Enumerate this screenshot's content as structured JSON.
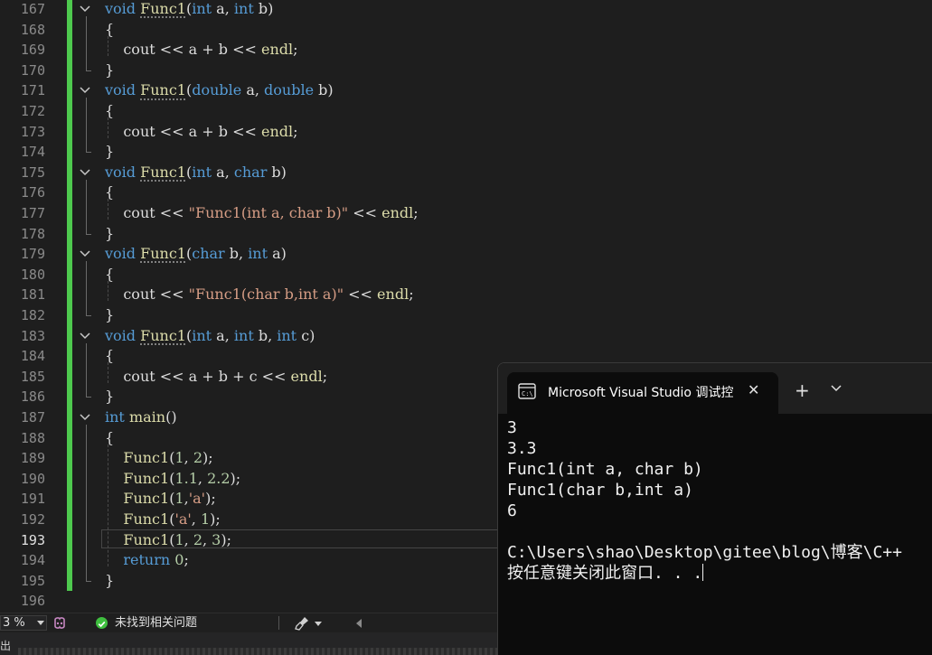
{
  "editor": {
    "lines": [
      {
        "n": "167",
        "tokens": [
          [
            "kw",
            "void"
          ],
          [
            "pl",
            " "
          ],
          [
            "fn",
            "Func1"
          ],
          [
            "pl",
            "("
          ],
          [
            "kw",
            "int"
          ],
          [
            "pl",
            " a, "
          ],
          [
            "kw",
            "int"
          ],
          [
            "pl",
            " b)"
          ]
        ]
      },
      {
        "n": "168",
        "tokens": [
          [
            "pl",
            "{"
          ]
        ]
      },
      {
        "n": "169",
        "tokens": [
          [
            "pl",
            "    cout << a + b << "
          ],
          [
            "fnp",
            "endl"
          ],
          [
            "pl",
            ";"
          ]
        ]
      },
      {
        "n": "170",
        "tokens": [
          [
            "pl",
            "}"
          ]
        ]
      },
      {
        "n": "171",
        "tokens": [
          [
            "kw",
            "void"
          ],
          [
            "pl",
            " "
          ],
          [
            "fn",
            "Func1"
          ],
          [
            "pl",
            "("
          ],
          [
            "kw",
            "double"
          ],
          [
            "pl",
            " a, "
          ],
          [
            "kw",
            "double"
          ],
          [
            "pl",
            " b)"
          ]
        ]
      },
      {
        "n": "172",
        "tokens": [
          [
            "pl",
            "{"
          ]
        ]
      },
      {
        "n": "173",
        "tokens": [
          [
            "pl",
            "    cout << a + b << "
          ],
          [
            "fnp",
            "endl"
          ],
          [
            "pl",
            ";"
          ]
        ]
      },
      {
        "n": "174",
        "tokens": [
          [
            "pl",
            "}"
          ]
        ]
      },
      {
        "n": "175",
        "tokens": [
          [
            "kw",
            "void"
          ],
          [
            "pl",
            " "
          ],
          [
            "fn",
            "Func1"
          ],
          [
            "pl",
            "("
          ],
          [
            "kw",
            "int"
          ],
          [
            "pl",
            " a, "
          ],
          [
            "kw",
            "char"
          ],
          [
            "pl",
            " b)"
          ]
        ]
      },
      {
        "n": "176",
        "tokens": [
          [
            "pl",
            "{"
          ]
        ]
      },
      {
        "n": "177",
        "tokens": [
          [
            "pl",
            "    cout << "
          ],
          [
            "st",
            "\"Func1(int a, char b)\""
          ],
          [
            "pl",
            " << "
          ],
          [
            "fnp",
            "endl"
          ],
          [
            "pl",
            ";"
          ]
        ]
      },
      {
        "n": "178",
        "tokens": [
          [
            "pl",
            "}"
          ]
        ]
      },
      {
        "n": "179",
        "tokens": [
          [
            "kw",
            "void"
          ],
          [
            "pl",
            " "
          ],
          [
            "fn",
            "Func1"
          ],
          [
            "pl",
            "("
          ],
          [
            "kw",
            "char"
          ],
          [
            "pl",
            " b, "
          ],
          [
            "kw",
            "int"
          ],
          [
            "pl",
            " a)"
          ]
        ]
      },
      {
        "n": "180",
        "tokens": [
          [
            "pl",
            "{"
          ]
        ]
      },
      {
        "n": "181",
        "tokens": [
          [
            "pl",
            "    cout << "
          ],
          [
            "st",
            "\"Func1(char b,int a)\""
          ],
          [
            "pl",
            " << "
          ],
          [
            "fnp",
            "endl"
          ],
          [
            "pl",
            ";"
          ]
        ]
      },
      {
        "n": "182",
        "tokens": [
          [
            "pl",
            "}"
          ]
        ]
      },
      {
        "n": "183",
        "tokens": [
          [
            "kw",
            "void"
          ],
          [
            "pl",
            " "
          ],
          [
            "fn",
            "Func1"
          ],
          [
            "pl",
            "("
          ],
          [
            "kw",
            "int"
          ],
          [
            "pl",
            " a, "
          ],
          [
            "kw",
            "int"
          ],
          [
            "pl",
            " b, "
          ],
          [
            "kw",
            "int"
          ],
          [
            "pl",
            " c)"
          ]
        ]
      },
      {
        "n": "184",
        "tokens": [
          [
            "pl",
            "{"
          ]
        ]
      },
      {
        "n": "185",
        "tokens": [
          [
            "pl",
            "    cout << a + b + c << "
          ],
          [
            "fnp",
            "endl"
          ],
          [
            "pl",
            ";"
          ]
        ]
      },
      {
        "n": "186",
        "tokens": [
          [
            "pl",
            "}"
          ]
        ]
      },
      {
        "n": "187",
        "tokens": [
          [
            "kw",
            "int"
          ],
          [
            "pl",
            " "
          ],
          [
            "fnp",
            "main"
          ],
          [
            "pl",
            "()"
          ]
        ]
      },
      {
        "n": "188",
        "tokens": [
          [
            "pl",
            "{"
          ]
        ]
      },
      {
        "n": "189",
        "tokens": [
          [
            "pl",
            "    "
          ],
          [
            "fnp",
            "Func1"
          ],
          [
            "pl",
            "("
          ],
          [
            "nm",
            "1"
          ],
          [
            "pl",
            ", "
          ],
          [
            "nm",
            "2"
          ],
          [
            "pl",
            ");"
          ]
        ]
      },
      {
        "n": "190",
        "tokens": [
          [
            "pl",
            "    "
          ],
          [
            "fnp",
            "Func1"
          ],
          [
            "pl",
            "("
          ],
          [
            "nm",
            "1.1"
          ],
          [
            "pl",
            ", "
          ],
          [
            "nm",
            "2.2"
          ],
          [
            "pl",
            ");"
          ]
        ]
      },
      {
        "n": "191",
        "tokens": [
          [
            "pl",
            "    "
          ],
          [
            "fnp",
            "Func1"
          ],
          [
            "pl",
            "("
          ],
          [
            "nm",
            "1"
          ],
          [
            "pl",
            ","
          ],
          [
            "st",
            "'a'"
          ],
          [
            "pl",
            ");"
          ]
        ]
      },
      {
        "n": "192",
        "tokens": [
          [
            "pl",
            "    "
          ],
          [
            "fnp",
            "Func1"
          ],
          [
            "pl",
            "("
          ],
          [
            "st",
            "'a'"
          ],
          [
            "pl",
            ", "
          ],
          [
            "nm",
            "1"
          ],
          [
            "pl",
            ");"
          ]
        ]
      },
      {
        "n": "193",
        "tokens": [
          [
            "pl",
            "    "
          ],
          [
            "fnp",
            "Func1"
          ],
          [
            "pl",
            "("
          ],
          [
            "nm",
            "1"
          ],
          [
            "pl",
            ", "
          ],
          [
            "nm",
            "2"
          ],
          [
            "pl",
            ", "
          ],
          [
            "nm",
            "3"
          ],
          [
            "pl",
            ");"
          ]
        ]
      },
      {
        "n": "194",
        "tokens": [
          [
            "pl",
            "    "
          ],
          [
            "kw",
            "return"
          ],
          [
            "pl",
            " "
          ],
          [
            "nm",
            "0"
          ],
          [
            "pl",
            ";"
          ]
        ]
      },
      {
        "n": "195",
        "tokens": [
          [
            "pl",
            "}"
          ]
        ]
      },
      {
        "n": "196",
        "tokens": []
      }
    ],
    "active_line": "193"
  },
  "status_bar": {
    "zoom": "3 %",
    "issues_text": "未找到相关问题",
    "bottom_label": "出"
  },
  "terminal": {
    "tab_title": "Microsoft Visual Studio 调试控",
    "close_glyph": "✕",
    "add_glyph": "+",
    "output": [
      "3",
      "3.3",
      "Func1(int a, char b)",
      "Func1(char b,int a)",
      "6",
      "",
      "C:\\Users\\shao\\Desktop\\gitee\\blog\\博客\\C++",
      "按任意键关闭此窗口. . ."
    ]
  },
  "colors": {
    "keyword": "#569cd6",
    "function": "#dcdcaa",
    "string": "#d69d85",
    "number": "#b5cea8",
    "change_bar": "#4ec94e"
  }
}
